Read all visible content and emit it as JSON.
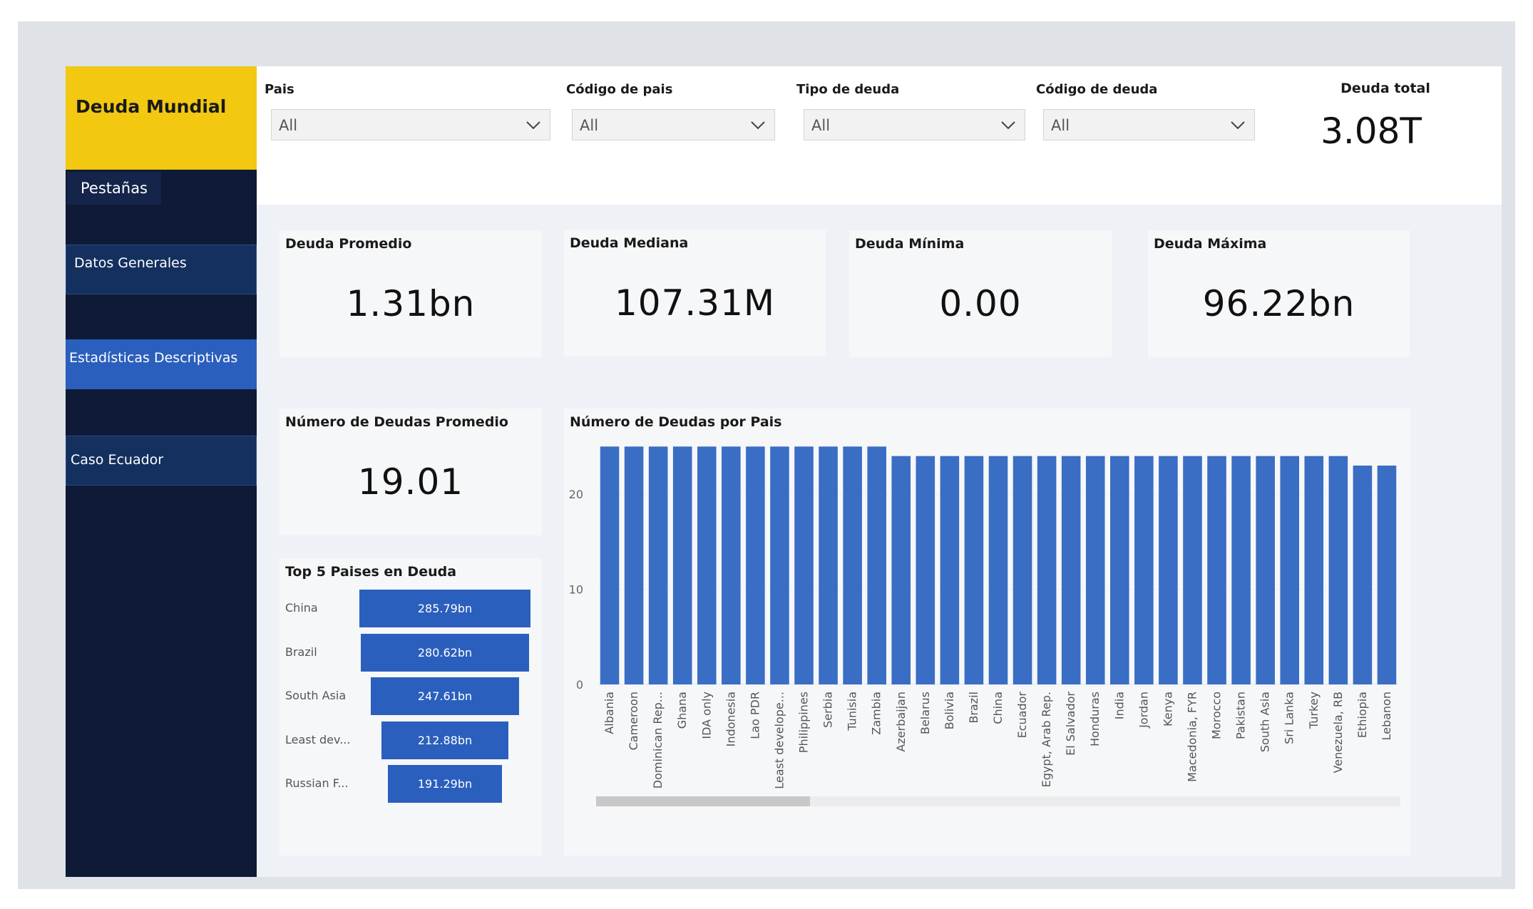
{
  "sidebar": {
    "title": "Deuda Mundial",
    "tabs_label": "Pestañas",
    "items": [
      {
        "label": "Datos Generales"
      },
      {
        "label": "Estadísticas Descriptivas"
      },
      {
        "label": "Caso Ecuador"
      }
    ]
  },
  "filters": [
    {
      "label": "Pais",
      "value": "All"
    },
    {
      "label": "Código de pais",
      "value": "All"
    },
    {
      "label": "Tipo de deuda",
      "value": "All"
    },
    {
      "label": "Código de deuda",
      "value": "All"
    }
  ],
  "total": {
    "label": "Deuda total",
    "value": "3.08T"
  },
  "kpis": [
    {
      "label": "Deuda Promedio",
      "value": "1.31bn"
    },
    {
      "label": "Deuda Mediana",
      "value": "107.31M"
    },
    {
      "label": "Deuda Mínima",
      "value": "0.00"
    },
    {
      "label": "Deuda Máxima",
      "value": "96.22bn"
    }
  ],
  "avg_count": {
    "label": "Número de Deudas Promedio",
    "value": "19.01"
  },
  "top5": {
    "title": "Top 5 Paises en Deuda",
    "rows": [
      {
        "name": "China",
        "value": 285.79,
        "label": "285.79bn"
      },
      {
        "name": "Brazil",
        "value": 280.62,
        "label": "280.62bn"
      },
      {
        "name": "South Asia",
        "value": 247.61,
        "label": "247.61bn"
      },
      {
        "name": "Least dev...",
        "value": 212.88,
        "label": "212.88bn"
      },
      {
        "name": "Russian F...",
        "value": 191.29,
        "label": "191.29bn"
      }
    ]
  },
  "chart_data": {
    "type": "bar",
    "title": "Número de Deudas por Pais",
    "xlabel": "",
    "ylabel": "",
    "ylim": [
      0,
      26
    ],
    "yticks": [
      0,
      10,
      20
    ],
    "grid": true,
    "categories": [
      "Albania",
      "Cameroon",
      "Dominican Rep...",
      "Ghana",
      "IDA only",
      "Indonesia",
      "Lao PDR",
      "Least develope...",
      "Philippines",
      "Serbia",
      "Tunisia",
      "Zambia",
      "Azerbaijan",
      "Belarus",
      "Bolivia",
      "Brazil",
      "China",
      "Ecuador",
      "Egypt, Arab Rep.",
      "El Salvador",
      "Honduras",
      "India",
      "Jordan",
      "Kenya",
      "Macedonia, FYR",
      "Morocco",
      "Pakistan",
      "South Asia",
      "Sri Lanka",
      "Turkey",
      "Venezuela, RB",
      "Ethiopia",
      "Lebanon"
    ],
    "values": [
      25,
      25,
      25,
      25,
      25,
      25,
      25,
      25,
      25,
      25,
      25,
      25,
      24,
      24,
      24,
      24,
      24,
      24,
      24,
      24,
      24,
      24,
      24,
      24,
      24,
      24,
      24,
      24,
      24,
      24,
      24,
      23,
      23
    ],
    "color": "#3a6dc4"
  }
}
